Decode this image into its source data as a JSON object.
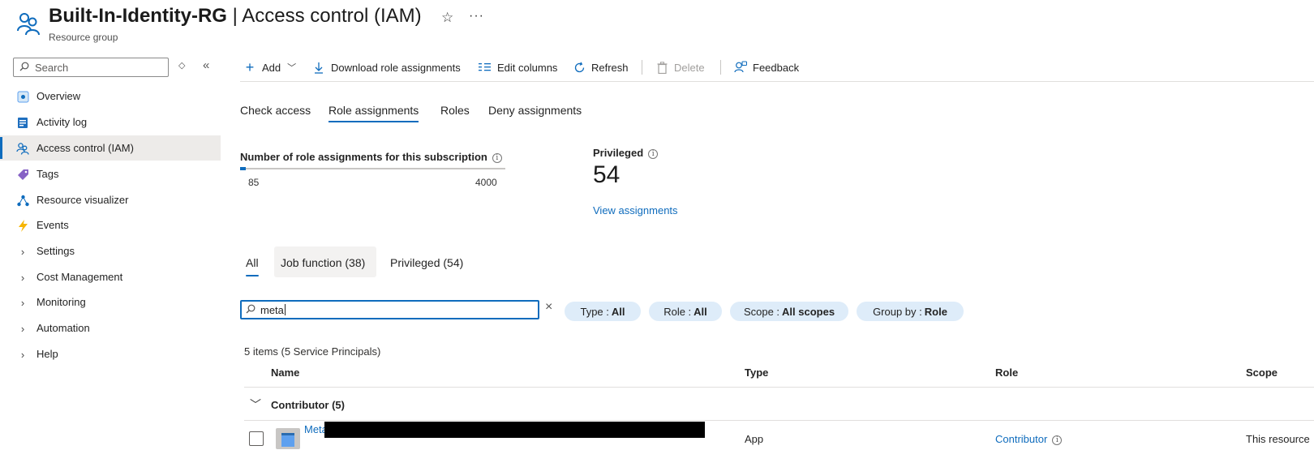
{
  "header": {
    "resource_name": "Built-In-Identity-RG",
    "separator": " | ",
    "page_name": "Access control (IAM)",
    "subtitle": "Resource group",
    "favorite_icon": "star-icon",
    "more_icon": "more-icon"
  },
  "sidebar": {
    "search_placeholder": "Search",
    "items": [
      {
        "label": "Overview",
        "icon": "overview-icon"
      },
      {
        "label": "Activity log",
        "icon": "activity-log-icon"
      },
      {
        "label": "Access control (IAM)",
        "icon": "people-icon",
        "active": true
      },
      {
        "label": "Tags",
        "icon": "tag-icon"
      },
      {
        "label": "Resource visualizer",
        "icon": "hierarchy-icon"
      },
      {
        "label": "Events",
        "icon": "lightning-icon"
      },
      {
        "label": "Settings",
        "icon": "chevron-right-icon"
      },
      {
        "label": "Cost Management",
        "icon": "chevron-right-icon"
      },
      {
        "label": "Monitoring",
        "icon": "chevron-right-icon"
      },
      {
        "label": "Automation",
        "icon": "chevron-right-icon"
      },
      {
        "label": "Help",
        "icon": "chevron-right-icon"
      }
    ]
  },
  "toolbar": {
    "add": "Add",
    "download": "Download role assignments",
    "edit_columns": "Edit columns",
    "refresh": "Refresh",
    "delete": "Delete",
    "feedback": "Feedback"
  },
  "tabs": [
    "Check access",
    "Role assignments",
    "Roles",
    "Deny assignments"
  ],
  "active_tab": "Role assignments",
  "stats": {
    "assignments_label": "Number of role assignments for this subscription",
    "assignments_current": "85",
    "assignments_max": "4000",
    "assignments_fraction": 0.02125,
    "privileged_label": "Privileged",
    "privileged_value": "54",
    "view_link": "View assignments"
  },
  "filter_tabs": [
    "All",
    "Job function (38)",
    "Privileged (54)"
  ],
  "search": {
    "value": "meta"
  },
  "pills": [
    {
      "key": "Type : ",
      "value": "All"
    },
    {
      "key": "Role : ",
      "value": "All"
    },
    {
      "key": "Scope : ",
      "value": "All scopes"
    },
    {
      "key": "Group by : ",
      "value": "Role"
    }
  ],
  "table": {
    "summary": "5 items (5 Service Principals)",
    "columns": [
      "Name",
      "Type",
      "Role",
      "Scope"
    ],
    "group_label": "Contributor (5)",
    "rows": [
      {
        "name": "Meta",
        "type": "App",
        "role": "Contributor",
        "scope": "This resource"
      }
    ]
  },
  "colors": {
    "accent": "#0f6cbd",
    "pill_bg": "#deecf9",
    "active_nav_bg": "#edebe9"
  }
}
